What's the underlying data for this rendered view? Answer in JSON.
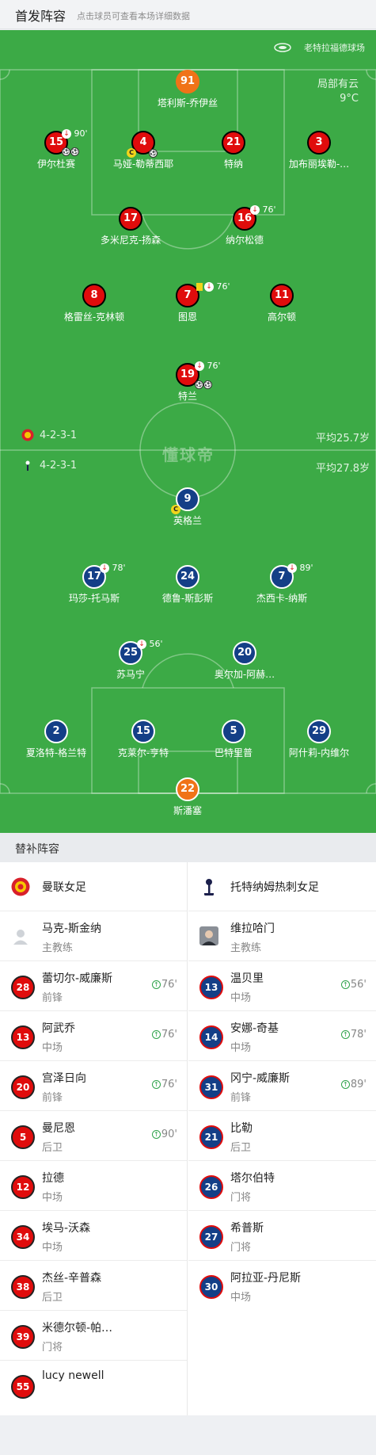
{
  "header": {
    "title": "首发阵容",
    "subtitle": "点击球员可查看本场详细数据"
  },
  "pitch": {
    "stadium": "老特拉福德球场",
    "weather": "局部有云",
    "temperature": "9°C",
    "watermark": "懂球帝",
    "home_formation": "4-2-3-1",
    "home_avg_age": "平均25.7岁",
    "away_formation": "4-2-3-1",
    "away_avg_age": "平均27.8岁",
    "home_players": [
      {
        "num": "91",
        "name": "塔利斯-乔伊丝"
      },
      {
        "num": "15",
        "name": "伊尔杜赛",
        "sub_time": "90'"
      },
      {
        "num": "4",
        "name": "马娅-勒蒂西耶"
      },
      {
        "num": "21",
        "name": "特纳"
      },
      {
        "num": "3",
        "name": "加布丽埃勒-…"
      },
      {
        "num": "17",
        "name": "多米尼克-扬森"
      },
      {
        "num": "16",
        "name": "纳尔松德",
        "sub_time": "76'"
      },
      {
        "num": "8",
        "name": "格雷丝-克林顿"
      },
      {
        "num": "7",
        "name": "图恩",
        "sub_time": "76'"
      },
      {
        "num": "11",
        "name": "高尔顿"
      },
      {
        "num": "19",
        "name": "特兰",
        "sub_time": "76'"
      }
    ],
    "away_players": [
      {
        "num": "9",
        "name": "英格兰"
      },
      {
        "num": "17",
        "name": "玛莎-托马斯",
        "sub_time": "78'"
      },
      {
        "num": "24",
        "name": "德鲁-斯彭斯"
      },
      {
        "num": "7",
        "name": "杰西卡-纳斯",
        "sub_time": "89'"
      },
      {
        "num": "25",
        "name": "苏马宁",
        "sub_time": "56'"
      },
      {
        "num": "20",
        "name": "奥尔加-阿赫…"
      },
      {
        "num": "2",
        "name": "夏洛特-格兰特"
      },
      {
        "num": "15",
        "name": "克莱尔-亨特"
      },
      {
        "num": "5",
        "name": "巴特里普"
      },
      {
        "num": "29",
        "name": "阿什莉-内维尔"
      },
      {
        "num": "22",
        "name": "斯潘塞"
      }
    ]
  },
  "subs_section": {
    "title": "替补阵容",
    "home_team": "曼联女足",
    "away_team": "托特纳姆热刺女足",
    "home_coach": {
      "name": "马克-斯金纳",
      "role": "主教练"
    },
    "away_coach": {
      "name": "维拉哈门",
      "role": "主教练"
    },
    "home_subs": [
      {
        "num": "28",
        "name": "蕾切尔-威廉斯",
        "pos": "前锋",
        "time": "76'"
      },
      {
        "num": "13",
        "name": "阿武乔",
        "pos": "中场",
        "time": "76'"
      },
      {
        "num": "20",
        "name": "宫泽日向",
        "pos": "前锋",
        "time": "76'"
      },
      {
        "num": "5",
        "name": "曼尼恩",
        "pos": "后卫",
        "time": "90'"
      },
      {
        "num": "12",
        "name": "拉德",
        "pos": "中场"
      },
      {
        "num": "34",
        "name": "埃马-沃森",
        "pos": "中场"
      },
      {
        "num": "38",
        "name": "杰丝-辛普森",
        "pos": "后卫"
      },
      {
        "num": "39",
        "name": "米德尔顿-帕…",
        "pos": "门将"
      },
      {
        "num": "55",
        "name": "lucy newell",
        "pos": ""
      }
    ],
    "away_subs": [
      {
        "num": "13",
        "name": "温贝里",
        "pos": "中场",
        "time": "56'"
      },
      {
        "num": "14",
        "name": "安娜-奇基",
        "pos": "中场",
        "time": "78'"
      },
      {
        "num": "31",
        "name": "冈宁-威廉斯",
        "pos": "前锋",
        "time": "89'"
      },
      {
        "num": "21",
        "name": "比勒",
        "pos": "后卫"
      },
      {
        "num": "26",
        "name": "塔尔伯特",
        "pos": "门将"
      },
      {
        "num": "27",
        "name": "希普斯",
        "pos": "门将"
      },
      {
        "num": "30",
        "name": "阿拉亚-丹尼斯",
        "pos": "中场"
      }
    ]
  }
}
